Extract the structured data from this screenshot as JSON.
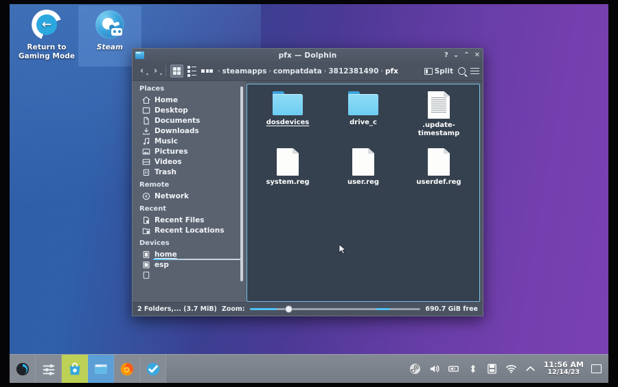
{
  "desktop": {
    "icons": [
      {
        "label": "Return to Gaming Mode",
        "icon": "return-arrow-icon",
        "selected": false
      },
      {
        "label": "Steam",
        "icon": "steam-icon",
        "selected": true
      }
    ],
    "wallpaper_colors": {
      "left": "#2e5ea8",
      "right": "#7a41b2"
    }
  },
  "window": {
    "title": "pfx — Dolphin",
    "titlebar_buttons": [
      {
        "name": "help",
        "glyph": "?"
      },
      {
        "name": "minimize",
        "glyph": "⌄"
      },
      {
        "name": "maximize",
        "glyph": "⌃"
      },
      {
        "name": "close",
        "glyph": "✕"
      }
    ],
    "toolbar": {
      "back_label": "‹",
      "forward_label": "›",
      "view_modes": [
        {
          "name": "icons-view",
          "active": true
        },
        {
          "name": "compact-view",
          "active": false
        },
        {
          "name": "details-view",
          "active": false
        }
      ],
      "split_label": "Split",
      "search_name": "search-icon",
      "menu_name": "hamburger-menu-icon"
    },
    "breadcrumb": {
      "leading_separator": "›",
      "separator": "›",
      "items": [
        {
          "label": "steamapps",
          "current": false
        },
        {
          "label": "compatdata",
          "current": false
        },
        {
          "label": "3812381490",
          "current": false
        },
        {
          "label": "pfx",
          "current": true
        }
      ]
    },
    "sidebar": {
      "sections": [
        {
          "title": "Places",
          "items": [
            {
              "label": "Home",
              "icon": "home-icon",
              "active": false
            },
            {
              "label": "Desktop",
              "icon": "desktop-icon",
              "active": false
            },
            {
              "label": "Documents",
              "icon": "documents-icon",
              "active": false
            },
            {
              "label": "Downloads",
              "icon": "downloads-icon",
              "active": false
            },
            {
              "label": "Music",
              "icon": "music-note-icon",
              "active": false
            },
            {
              "label": "Pictures",
              "icon": "pictures-icon",
              "active": false
            },
            {
              "label": "Videos",
              "icon": "videos-icon",
              "active": false
            },
            {
              "label": "Trash",
              "icon": "trash-icon",
              "active": false
            }
          ]
        },
        {
          "title": "Remote",
          "items": [
            {
              "label": "Network",
              "icon": "network-icon",
              "active": false
            }
          ]
        },
        {
          "title": "Recent",
          "items": [
            {
              "label": "Recent Files",
              "icon": "recent-files-icon",
              "active": false
            },
            {
              "label": "Recent Locations",
              "icon": "recent-locations-icon",
              "active": false
            }
          ]
        },
        {
          "title": "Devices",
          "items": [
            {
              "label": "home",
              "icon": "drive-icon",
              "active": true
            },
            {
              "label": "esp",
              "icon": "drive-icon",
              "active": false
            }
          ]
        }
      ]
    },
    "files": [
      {
        "name": "dosdevices",
        "type": "folder",
        "selected": true
      },
      {
        "name": "drive_c",
        "type": "folder",
        "selected": false
      },
      {
        "name": ".update-timestamp",
        "type": "file-lined",
        "selected": false
      },
      {
        "name": "system.reg",
        "type": "file",
        "selected": false
      },
      {
        "name": "user.reg",
        "type": "file",
        "selected": false
      },
      {
        "name": "userdef.reg",
        "type": "file",
        "selected": false
      }
    ],
    "statusbar": {
      "selection_info": "2 Folders,... (3.7 MiB)",
      "zoom_label": "Zoom:",
      "free_space": "690.7 GiB free"
    }
  },
  "taskbar": {
    "launchers": [
      {
        "name": "kde-menu",
        "highlight": "none"
      },
      {
        "name": "settings",
        "highlight": "none"
      },
      {
        "name": "discover-store",
        "highlight": "green"
      },
      {
        "name": "dolphin-file-manager",
        "highlight": "blue"
      },
      {
        "name": "firefox",
        "highlight": "none"
      },
      {
        "name": "steam-checkmark",
        "highlight": "none"
      }
    ],
    "tray": [
      {
        "name": "steam-tray-icon"
      },
      {
        "name": "volume-icon"
      },
      {
        "name": "audio-device-icon"
      },
      {
        "name": "bluetooth-icon"
      },
      {
        "name": "storage-icon"
      },
      {
        "name": "wifi-icon"
      },
      {
        "name": "tray-expand-icon"
      }
    ],
    "clock": {
      "time": "11:56 AM",
      "date": "12/14/23"
    },
    "show_desktop_name": "show-desktop-button"
  }
}
